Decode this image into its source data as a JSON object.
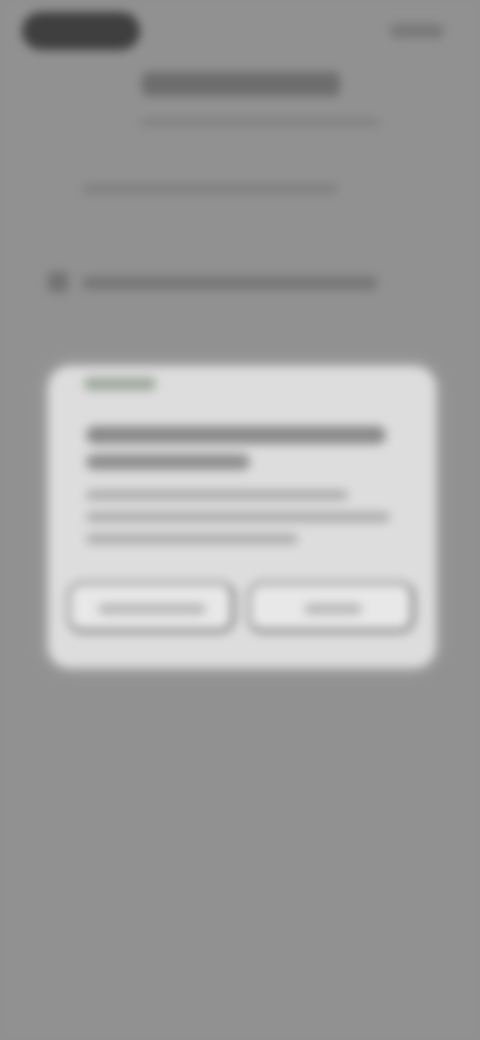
{
  "screen": {
    "background_color": "#8f8f8f",
    "blur_state": "heavily blurred"
  },
  "status_bar": {
    "left_pill_icon": "status-pill-icon",
    "right_indicators_icon": "status-indicators-icon"
  },
  "page": {
    "title": "",
    "subtitle": "",
    "content": "",
    "checkbox_label": ""
  },
  "dialog": {
    "eyebrow": "",
    "title": "",
    "body": "",
    "left_button_label": "",
    "right_button_label": ""
  }
}
